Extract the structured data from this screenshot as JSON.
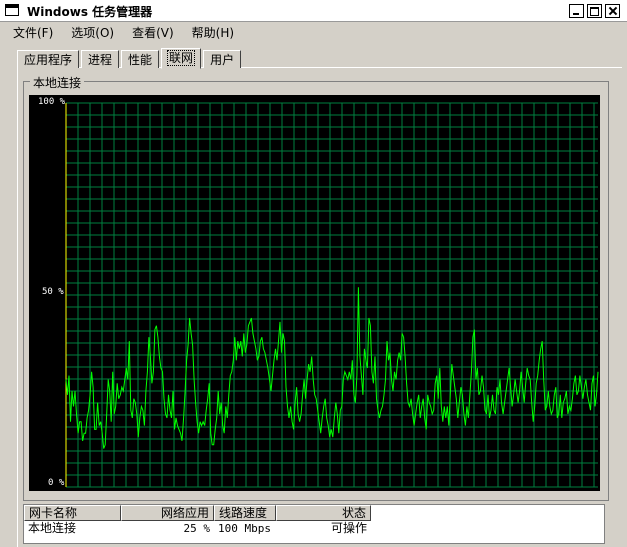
{
  "window": {
    "title": "Windows 任务管理器"
  },
  "menu": [
    "文件(F)",
    "选项(O)",
    "查看(V)",
    "帮助(H)"
  ],
  "tabs": [
    {
      "label": "应用程序",
      "active": false
    },
    {
      "label": "进程",
      "active": false
    },
    {
      "label": "性能",
      "active": false
    },
    {
      "label": "联网",
      "active": true
    },
    {
      "label": "用户",
      "active": false
    }
  ],
  "group": {
    "label": "本地连接"
  },
  "graph": {
    "y_labels": {
      "top": "100 %",
      "mid": "50 %",
      "bottom": "0 %"
    },
    "colors": {
      "grid": "#008040",
      "line": "#00ff00",
      "background": "#000000"
    }
  },
  "chart_data": {
    "type": "line",
    "ylim": [
      0,
      100
    ],
    "series": [
      {
        "values": [
          28,
          24,
          29,
          17,
          25,
          21,
          25,
          19,
          14,
          17,
          17,
          12,
          14,
          14,
          18,
          20,
          24,
          30,
          26,
          15,
          15,
          22,
          16,
          17,
          14,
          10,
          11,
          19,
          28,
          25,
          17,
          30,
          19,
          21,
          27,
          23,
          24,
          26,
          25,
          28,
          31,
          28,
          38,
          20,
          18,
          23,
          22,
          19,
          13,
          18,
          21,
          20,
          16,
          25,
          30,
          39,
          34,
          27,
          30,
          41,
          42,
          39,
          34,
          31,
          30,
          23,
          19,
          18,
          24,
          20,
          18,
          25,
          15,
          18,
          16,
          15,
          14,
          12,
          18,
          25,
          33,
          37,
          44,
          40,
          37,
          28,
          22,
          17,
          14,
          17,
          16,
          17,
          16,
          20,
          23,
          27,
          14,
          11,
          11,
          15,
          18,
          25,
          19,
          22,
          16,
          14,
          21,
          18,
          24,
          29,
          30,
          33,
          39,
          33,
          38,
          36,
          38,
          34,
          40,
          35,
          37,
          42,
          43,
          44,
          40,
          38,
          36,
          33,
          34,
          38,
          39,
          36,
          35,
          33,
          31,
          28,
          25,
          29,
          33,
          36,
          33,
          38,
          43,
          35,
          40,
          38,
          26,
          21,
          18,
          21,
          17,
          15,
          22,
          26,
          19,
          17,
          19,
          24,
          28,
          23,
          28,
          32,
          30,
          34,
          28,
          24,
          23,
          20,
          17,
          14,
          18,
          21,
          23,
          18,
          16,
          13,
          15,
          13,
          18,
          22,
          19,
          14,
          20,
          21,
          28,
          30,
          29,
          28,
          30,
          28,
          33,
          24,
          22,
          29,
          52,
          34,
          29,
          24,
          36,
          33,
          31,
          44,
          42,
          30,
          27,
          34,
          23,
          20,
          18,
          20,
          21,
          24,
          28,
          38,
          33,
          35,
          28,
          25,
          30,
          28,
          33,
          35,
          33,
          40,
          39,
          34,
          27,
          22,
          21,
          23,
          19,
          16,
          19,
          22,
          24,
          18,
          21,
          23,
          18,
          15,
          24,
          22,
          21,
          19,
          20,
          27,
          29,
          23,
          31,
          21,
          17,
          21,
          18,
          21,
          16,
          24,
          32,
          29,
          26,
          23,
          18,
          22,
          26,
          24,
          19,
          16,
          21,
          18,
          24,
          30,
          39,
          41,
          28,
          31,
          24,
          25,
          29,
          26,
          20,
          19,
          24,
          18,
          20,
          24,
          20,
          19,
          26,
          24,
          28,
          22,
          19,
          22,
          25,
          28,
          31,
          26,
          21,
          24,
          28,
          25,
          22,
          25,
          30,
          26,
          22,
          27,
          31,
          29,
          28,
          22,
          17,
          21,
          27,
          29,
          33,
          36,
          38,
          28,
          20,
          21,
          25,
          21,
          19,
          20,
          24,
          26,
          18,
          19,
          24,
          18,
          22,
          23,
          25,
          19,
          21,
          20,
          23,
          27,
          29,
          24,
          25,
          29,
          26,
          23,
          26,
          28,
          24,
          22,
          20,
          27,
          29,
          21,
          24,
          30
        ]
      }
    ]
  },
  "adapters": {
    "columns": [
      "网卡名称",
      "网络应用",
      "线路速度",
      "状态"
    ],
    "rows": [
      {
        "name": "本地连接",
        "utilization": "25 %",
        "speed": "100 Mbps",
        "state": "可操作"
      }
    ]
  }
}
